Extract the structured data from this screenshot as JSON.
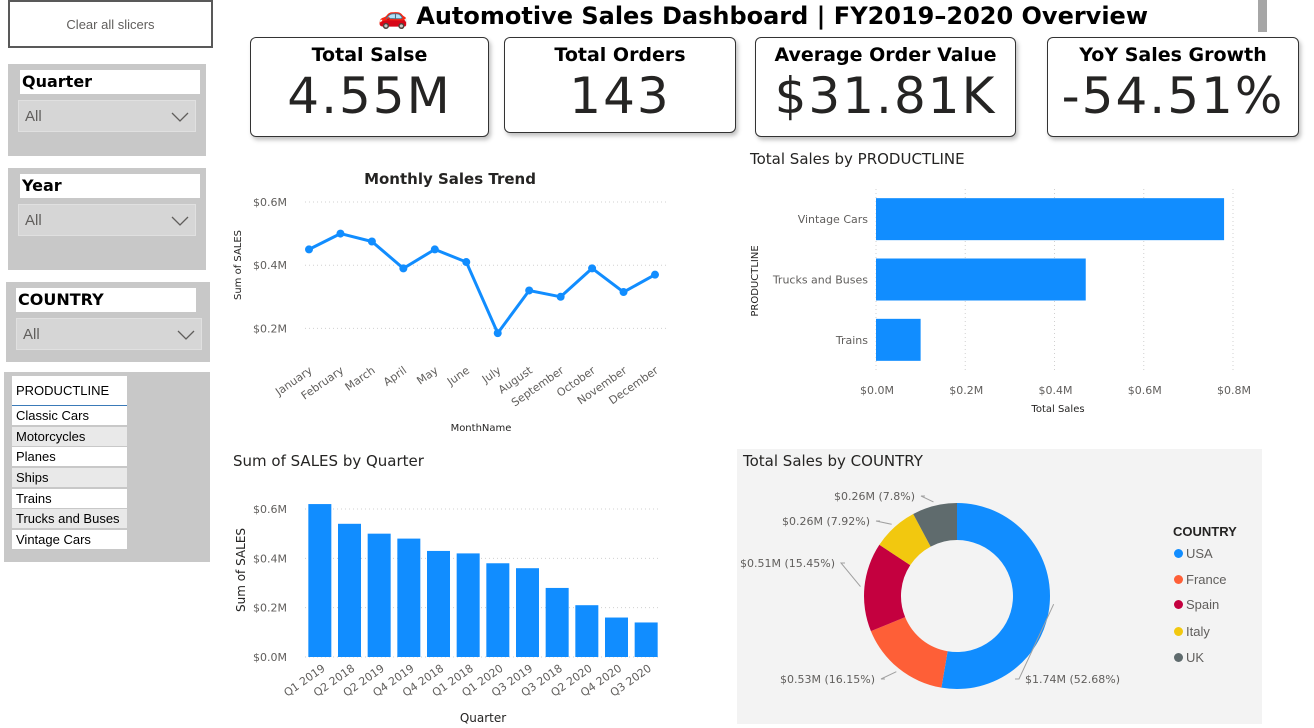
{
  "header": {
    "title": "🚗 Automotive Sales Dashboard | FY2019–2020 Overview"
  },
  "clear_slicers_label": "Clear all slicers",
  "slicers": {
    "quarter": {
      "label": "Quarter",
      "value": "All"
    },
    "year": {
      "label": "Year",
      "value": "All"
    },
    "country": {
      "label": "COUNTRY",
      "value": "All"
    }
  },
  "productline_slicer": {
    "header": "PRODUCTLINE",
    "items": [
      "Classic Cars",
      "Motorcycles",
      "Planes",
      "Ships",
      "Trains",
      "Trucks and Buses",
      "Vintage Cars"
    ]
  },
  "kpis": [
    {
      "label": "Total Salse",
      "value": "4.55M"
    },
    {
      "label": "Total Orders",
      "value": "143"
    },
    {
      "label": "Average Order Value",
      "value": "$31.81K"
    },
    {
      "label": "YoY Sales Growth",
      "value": "-54.51%"
    }
  ],
  "charts": {
    "monthly": {
      "title": "Monthly Sales Trend",
      "xlabel": "MonthName",
      "ylabel": "Sum of SALES",
      "y_ticks": [
        "$0.2M",
        "$0.4M",
        "$0.6M"
      ],
      "line_color": "#118dff",
      "chart_data": {
        "type": "line",
        "x": [
          "January",
          "February",
          "March",
          "April",
          "May",
          "June",
          "July",
          "August",
          "September",
          "October",
          "November",
          "December"
        ],
        "values": [
          0.45,
          0.5,
          0.475,
          0.39,
          0.45,
          0.41,
          0.185,
          0.32,
          0.3,
          0.39,
          0.315,
          0.37
        ],
        "ylim": [
          0.1,
          0.6
        ]
      }
    },
    "productline": {
      "title": "Total Sales by PRODUCTLINE",
      "xlabel": "Total Sales",
      "ylabel": "PRODUCTLINE",
      "x_ticks": [
        "$0.0M",
        "$0.2M",
        "$0.4M",
        "$0.6M",
        "$0.8M"
      ],
      "bar_color": "#118dff",
      "chart_data": {
        "type": "bar",
        "orientation": "horizontal",
        "categories": [
          "Vintage Cars",
          "Trucks and Buses",
          "Trains"
        ],
        "values": [
          0.78,
          0.47,
          0.1
        ],
        "xlim": [
          0,
          0.8
        ]
      }
    },
    "quarter": {
      "title": "Sum of SALES by Quarter",
      "xlabel": "Quarter",
      "ylabel": "Sum of SALES",
      "y_ticks": [
        "$0.0M",
        "$0.2M",
        "$0.4M",
        "$0.6M"
      ],
      "bar_color": "#118dff",
      "chart_data": {
        "type": "bar",
        "categories": [
          "Q1 2019",
          "Q2 2018",
          "Q2 2019",
          "Q4 2019",
          "Q4 2018",
          "Q1 2018",
          "Q1 2020",
          "Q3 2019",
          "Q3 2018",
          "Q2 2020",
          "Q4 2020",
          "Q3 2020"
        ],
        "values": [
          0.62,
          0.54,
          0.5,
          0.48,
          0.43,
          0.42,
          0.38,
          0.36,
          0.28,
          0.21,
          0.16,
          0.14
        ],
        "ylim": [
          0,
          0.6
        ]
      }
    },
    "country": {
      "title": "Total Sales by COUNTRY",
      "legend_title": "COUNTRY",
      "chart_data": {
        "type": "pie",
        "style": "donut",
        "slices": [
          {
            "name": "USA",
            "value": 1.74,
            "pct": 52.68,
            "label": "$1.74M (52.68%)",
            "color": "#118dff"
          },
          {
            "name": "France",
            "value": 0.53,
            "pct": 16.15,
            "label": "$0.53M (16.15%)",
            "color": "#fe5f37"
          },
          {
            "name": "Spain",
            "value": 0.51,
            "pct": 15.45,
            "label": "$0.51M (15.45%)",
            "color": "#c4003f"
          },
          {
            "name": "Italy",
            "value": 0.26,
            "pct": 7.92,
            "label": "$0.26M (7.92%)",
            "color": "#f2c80f"
          },
          {
            "name": "UK",
            "value": 0.26,
            "pct": 7.8,
            "label": "$0.26M (7.8%)",
            "color": "#5f6b6d"
          }
        ]
      }
    }
  }
}
